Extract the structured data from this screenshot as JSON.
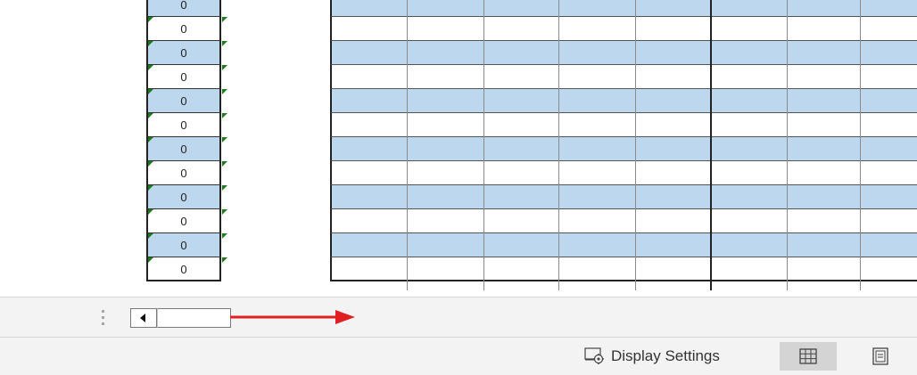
{
  "sheet": {
    "columnA_values": [
      "0",
      "0",
      "0",
      "0",
      "0",
      "0",
      "0",
      "0",
      "0",
      "0",
      "0",
      "0"
    ],
    "row_fill": [
      "blue",
      "white",
      "blue",
      "white",
      "blue",
      "white",
      "blue",
      "white",
      "blue",
      "white",
      "blue",
      "white"
    ],
    "colors": {
      "band_fill": "#bdd7ee",
      "error_indicator": "#1e7a1e"
    }
  },
  "scrollbar": {
    "annotation_color": "#e02020"
  },
  "statusbar": {
    "display_settings_label": "Display Settings",
    "display_settings_icon": "display-settings-icon",
    "view_normal_icon": "normal-view-icon",
    "view_page_icon": "page-layout-view-icon",
    "active_view": "normal"
  }
}
